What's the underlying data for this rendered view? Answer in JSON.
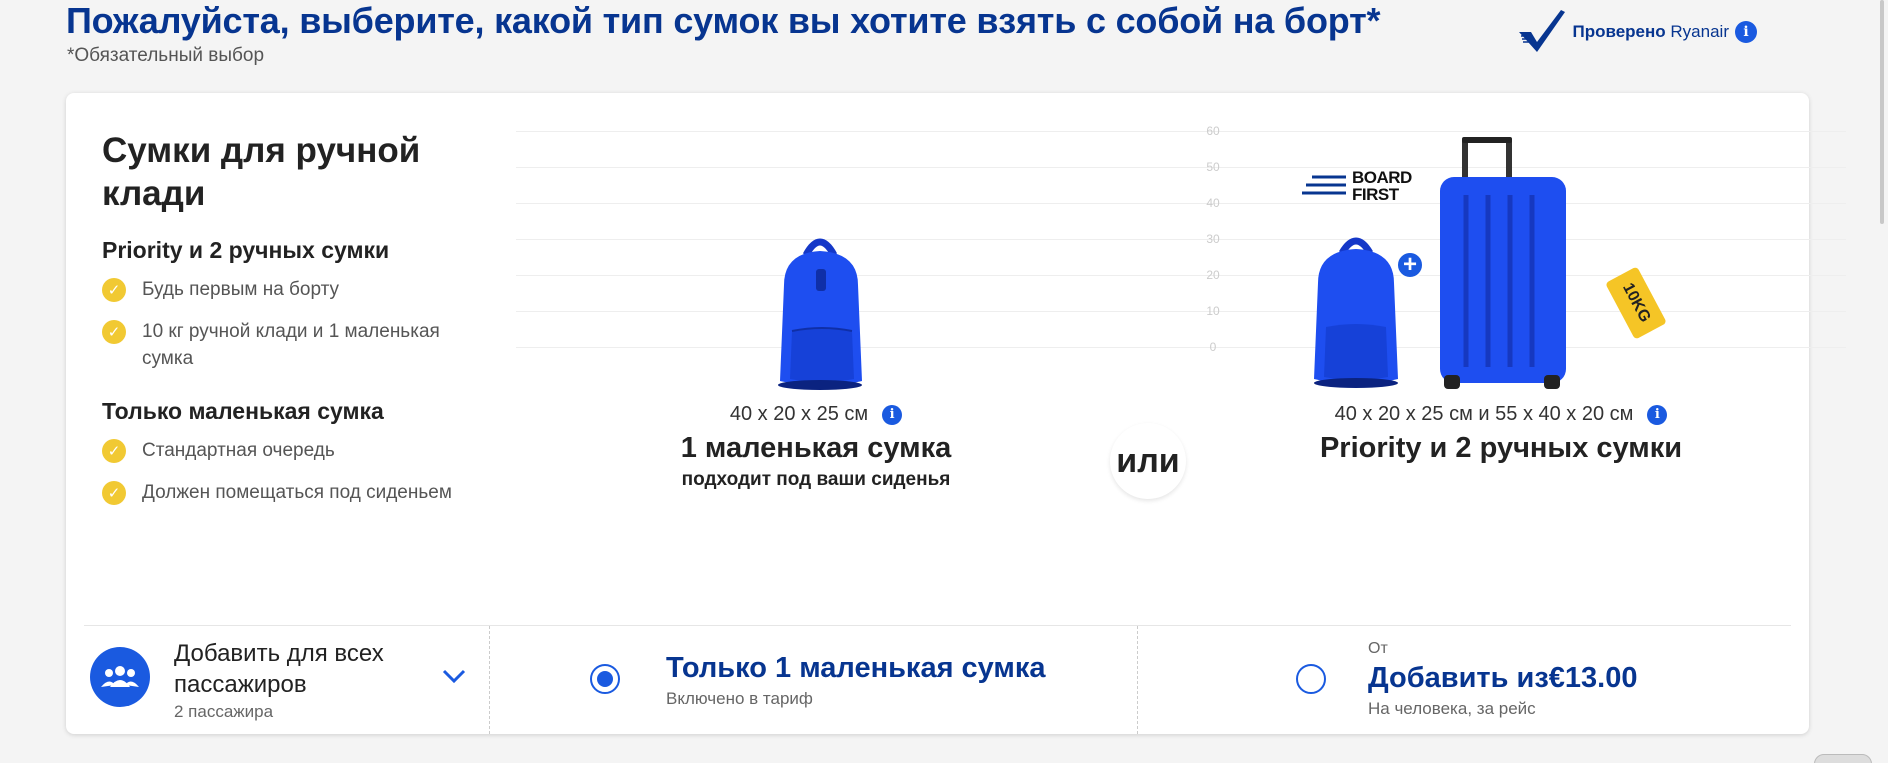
{
  "header": {
    "title": "Пожалуйста, выберите, какой тип сумок вы хотите взять с собой на борт*",
    "required_note": "*Обязательный выбор",
    "verified_bold": "Проверено",
    "verified_brand": "Ryanair"
  },
  "card": {
    "section_title": "Сумки для ручной клади",
    "groups": [
      {
        "heading": "Priority и 2 ручных сумки",
        "items": [
          "Будь первым на борту",
          "10 кг ручной клади и 1 маленькая сумка"
        ]
      },
      {
        "heading": "Только маленькая сумка",
        "items": [
          "Стандартная очередь",
          "Должен помещаться под сиденьем"
        ]
      }
    ],
    "grid_labels": [
      "60",
      "50",
      "40",
      "30",
      "20",
      "10",
      "0"
    ],
    "option_small": {
      "dims": "40 x 20 x 25 см",
      "title": "1 маленькая сумка",
      "subtitle": "подходит под ваши сиденья"
    },
    "or_label": "или",
    "option_priority": {
      "dims": "40 x 20 x 25 см и 55 x 40 x 20 см",
      "title": "Priority и 2 ручных сумки",
      "board_first_line1": "BOARD",
      "board_first_line2": "FIRST",
      "tag_text": "10KG"
    }
  },
  "bottom": {
    "add_all_label": "Добавить для всех пассажиров",
    "passengers": "2 пассажира",
    "small_title": "Только 1 маленькая сумка",
    "small_sub": "Включено в тариф",
    "small_selected": true,
    "from_label": "От",
    "priority_title": "Добавить из€13.00",
    "priority_sub": "На человека, за рейс",
    "priority_selected": false
  },
  "colors": {
    "brand_blue": "#073590",
    "accent_blue": "#1a5ae0",
    "bullet_yellow": "#f1c933",
    "bag_blue": "#1e4ef0"
  },
  "icons": [
    "check-icon",
    "info-icon",
    "plus-icon",
    "passengers-icon",
    "chevron-down-icon"
  ]
}
